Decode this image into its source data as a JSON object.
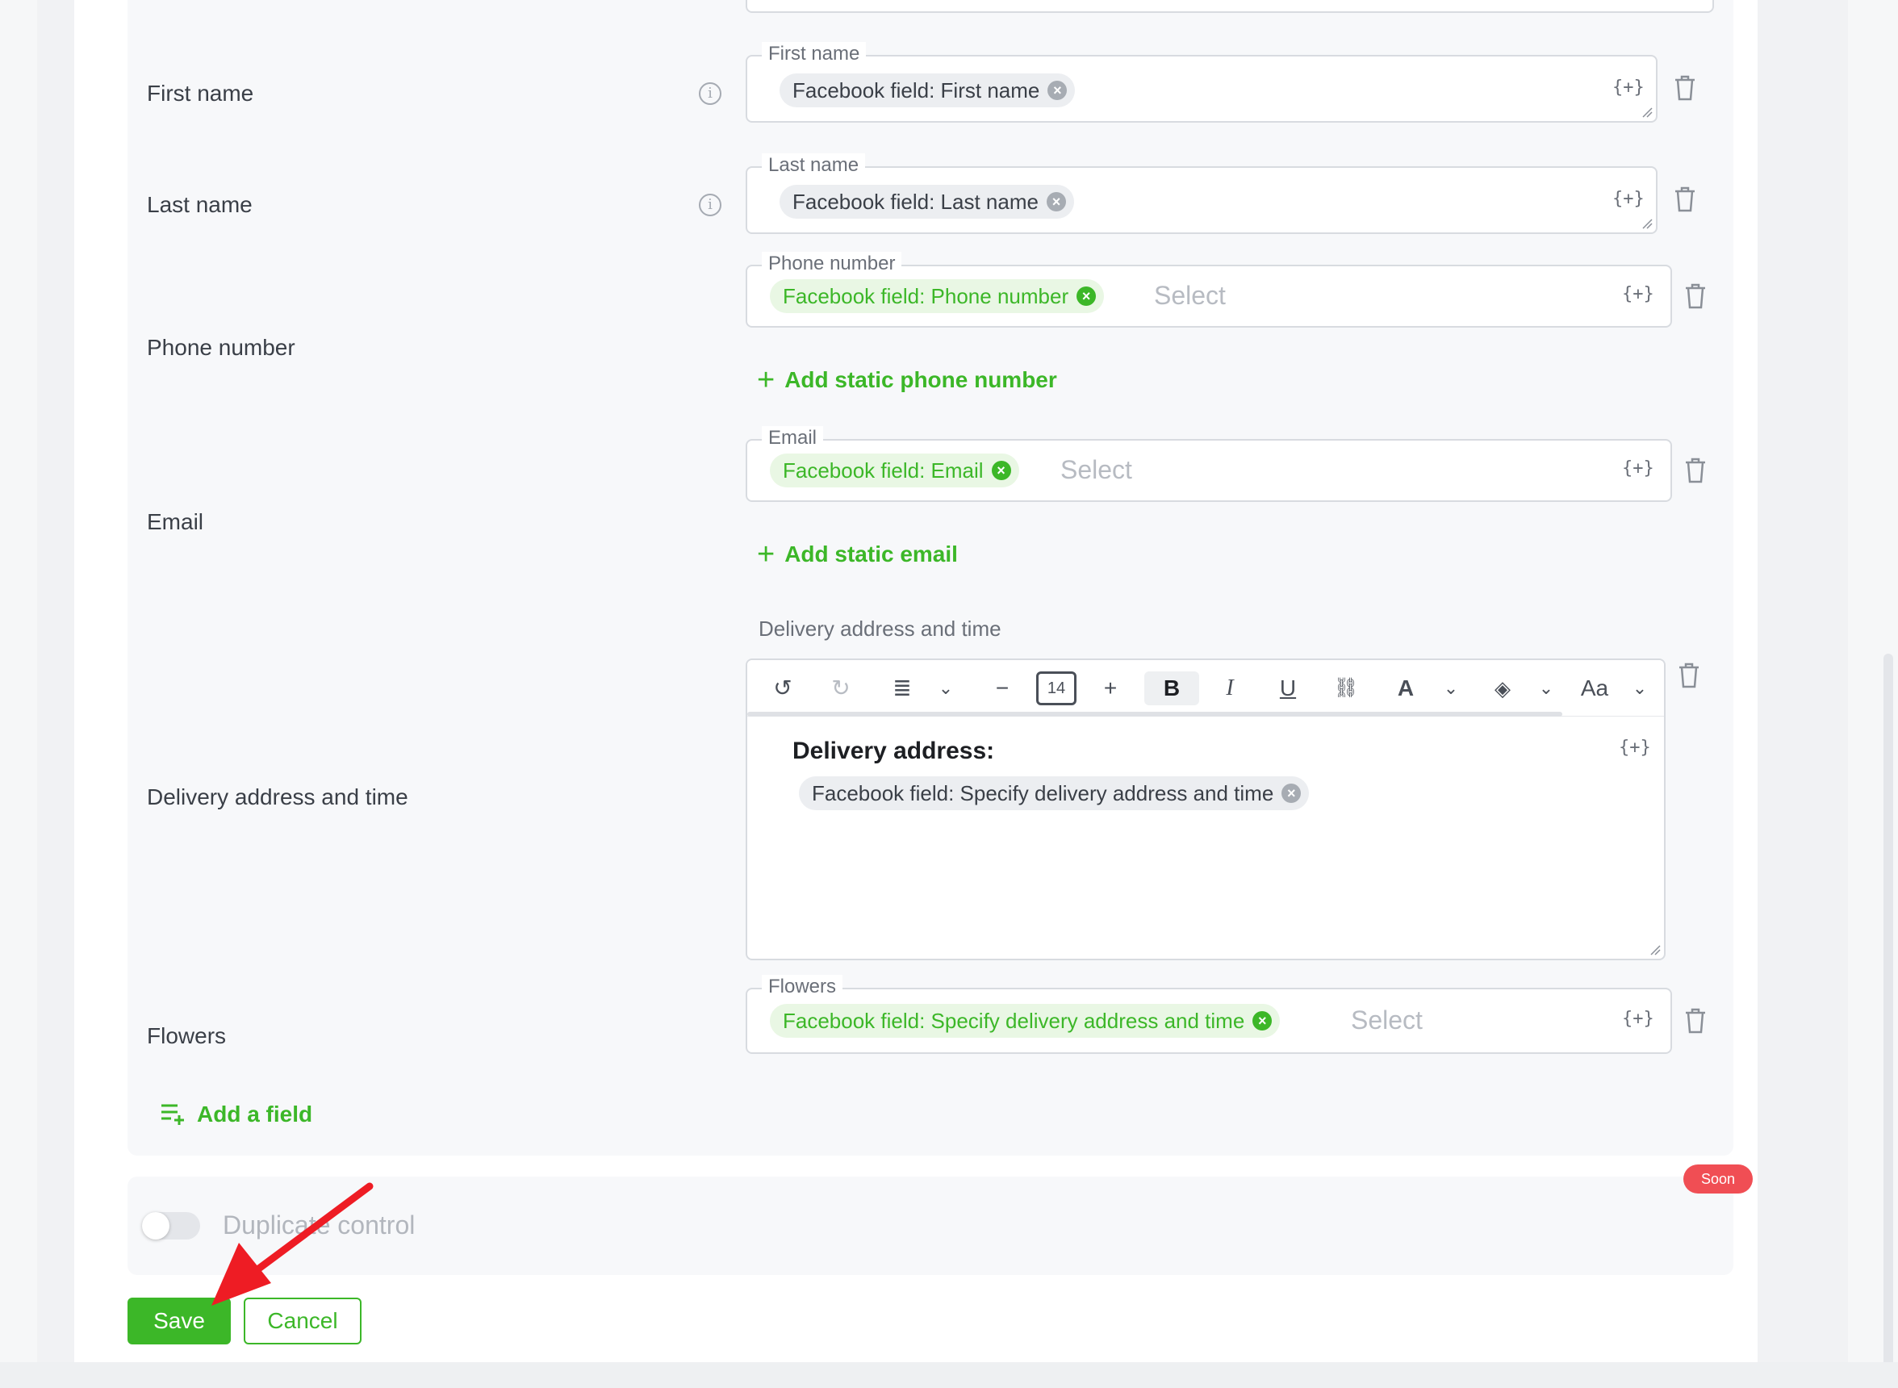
{
  "fields": {
    "first_name": {
      "row_label": "First name",
      "legend": "First name",
      "chip": "Facebook field: First name",
      "var": "{+}"
    },
    "last_name": {
      "row_label": "Last name",
      "legend": "Last name",
      "chip": "Facebook field: Last name",
      "var": "{+}"
    },
    "phone": {
      "row_label": "Phone number",
      "legend": "Phone number",
      "chip": "Facebook field: Phone number",
      "placeholder": "Select",
      "var": "{+}",
      "add_link": "Add static phone number"
    },
    "email": {
      "row_label": "Email",
      "legend": "Email",
      "chip": "Facebook field: Email",
      "placeholder": "Select",
      "var": "{+}",
      "add_link": "Add static email"
    },
    "delivery": {
      "row_label": "Delivery address and time",
      "legend": "Delivery address and time",
      "font_size": "14",
      "heading": "Delivery address:",
      "chip": "Facebook field: Specify delivery address and time",
      "var": "{+}"
    },
    "flowers": {
      "row_label": "Flowers",
      "legend": "Flowers",
      "chip": "Facebook field: Specify delivery address and time",
      "placeholder": "Select",
      "var": "{+}"
    }
  },
  "add_field_label": "Add a field",
  "duplicate_control": {
    "label": "Duplicate control",
    "badge": "Soon",
    "enabled": false
  },
  "actions": {
    "save": "Save",
    "cancel": "Cancel"
  },
  "icons": [
    "info-icon",
    "variable-icon",
    "trash-icon",
    "close-icon",
    "plus-icon",
    "undo-icon",
    "redo-icon",
    "align-icon",
    "chevron-down-icon",
    "minus-icon",
    "bold-icon",
    "italic-icon",
    "underline-icon",
    "link-icon",
    "text-color-icon",
    "fill-color-icon",
    "font-case-icon",
    "add-field-icon"
  ],
  "colors": {
    "accent": "#3cb728",
    "badge": "#f04e54",
    "arrow": "#ee1c24"
  }
}
